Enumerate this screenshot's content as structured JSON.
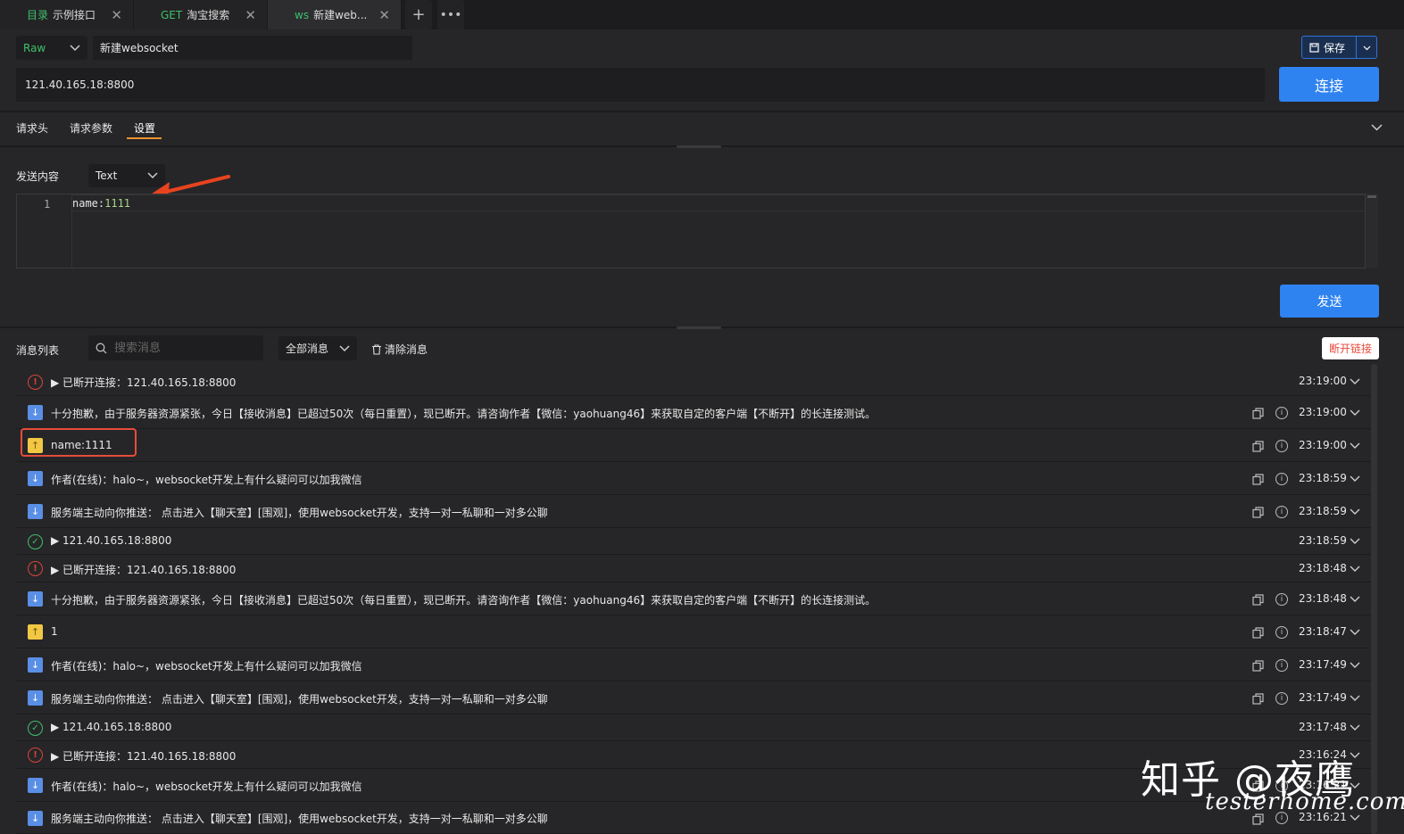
{
  "tabs": [
    {
      "method": "目录",
      "method_color": "#3fbf6b",
      "name": "示例接口",
      "active": false
    },
    {
      "method": "GET",
      "method_color": "#3fbf6b",
      "name": "淘宝搜索",
      "active": false
    },
    {
      "method": "ws",
      "method_color": "#3fbf6b",
      "name": "新建web...",
      "active": true
    }
  ],
  "toolbar": {
    "mode": "Raw",
    "name_value": "新建websocket",
    "save_label": "保存",
    "url_value": "121.40.165.18:8800",
    "connect_label": "连接"
  },
  "subtabs": [
    "请求头",
    "请求参数",
    "设置"
  ],
  "send": {
    "label": "发送内容",
    "type": "Text",
    "line_number": "1",
    "code_key": "name:",
    "code_val": "1111",
    "send_label": "发送"
  },
  "list": {
    "label": "消息列表",
    "search_placeholder": "搜索消息",
    "filter": "全部消息",
    "clear_label": "清除消息",
    "disconnect_label": "断开链接"
  },
  "messages": [
    {
      "type": "err",
      "text": "▶ 已断开连接：121.40.165.18:8800",
      "time": "23:19:00",
      "actions": false
    },
    {
      "type": "down",
      "text": "十分抱歉，由于服务器资源紧张，今日【接收消息】已超过50次（每日重置），现已断开。请咨询作者【微信：yaohuang46】来获取自定的客户端【不断开】的长连接测试。",
      "time": "23:19:00",
      "actions": true
    },
    {
      "type": "up",
      "text": "name:1111",
      "time": "23:19:00",
      "actions": true
    },
    {
      "type": "down",
      "text": "作者(在线)：halo~，websocket开发上有什么疑问可以加我微信",
      "time": "23:18:59",
      "actions": true
    },
    {
      "type": "down",
      "text": "服务端主动向你推送： 点击进入【聊天室】[围观]，使用websocket开发，支持一对一私聊和一对多公聊",
      "time": "23:18:59",
      "actions": true
    },
    {
      "type": "ok",
      "text": "▶ 121.40.165.18:8800",
      "time": "23:18:59",
      "actions": false
    },
    {
      "type": "err",
      "text": "▶ 已断开连接：121.40.165.18:8800",
      "time": "23:18:48",
      "actions": false
    },
    {
      "type": "down",
      "text": "十分抱歉，由于服务器资源紧张，今日【接收消息】已超过50次（每日重置），现已断开。请咨询作者【微信：yaohuang46】来获取自定的客户端【不断开】的长连接测试。",
      "time": "23:18:48",
      "actions": true
    },
    {
      "type": "up",
      "text": "1",
      "time": "23:18:47",
      "actions": true
    },
    {
      "type": "down",
      "text": "作者(在线)：halo~，websocket开发上有什么疑问可以加我微信",
      "time": "23:17:49",
      "actions": true
    },
    {
      "type": "down",
      "text": "服务端主动向你推送： 点击进入【聊天室】[围观]，使用websocket开发，支持一对一私聊和一对多公聊",
      "time": "23:17:49",
      "actions": true
    },
    {
      "type": "ok",
      "text": "▶ 121.40.165.18:8800",
      "time": "23:17:48",
      "actions": false
    },
    {
      "type": "err",
      "text": "▶ 已断开连接：121.40.165.18:8800",
      "time": "23:16:24",
      "actions": false
    },
    {
      "type": "down",
      "text": "作者(在线)：halo~，websocket开发上有什么疑问可以加我微信",
      "time": "23:16:21",
      "actions": true
    },
    {
      "type": "down",
      "text": "服务端主动向你推送： 点击进入【聊天室】[围观]，使用websocket开发，支持一对一私聊和一对多公聊",
      "time": "23:16:21",
      "actions": true
    }
  ],
  "icons": {
    "err": "error-circle-icon",
    "ok": "check-circle-icon",
    "down": "arrow-down-icon",
    "up": "arrow-up-icon"
  },
  "watermark": {
    "line1": "知乎 @夜鹰",
    "line2": "testerhome.com"
  }
}
